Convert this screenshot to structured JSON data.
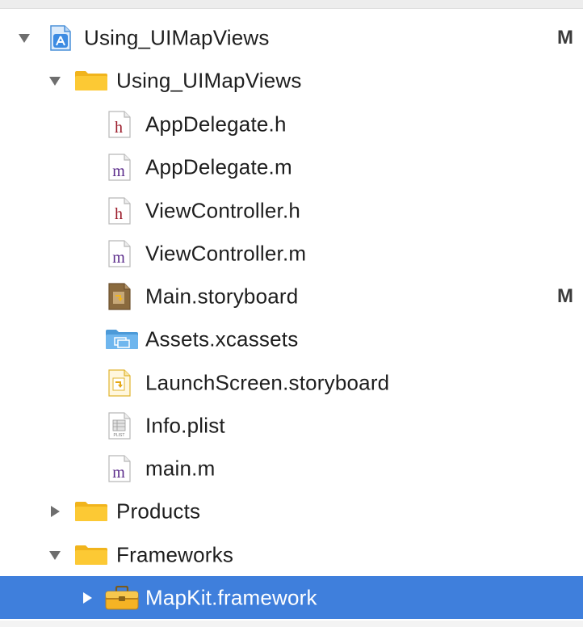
{
  "colors": {
    "selection": "#3f7fdc",
    "header_letter": "#9b1b2a",
    "impl_letter": "#5a2a8a",
    "folder": "#f5c518"
  },
  "tree": {
    "rows": [
      {
        "label": "Using_UIMapViews",
        "icon": "xcode-project-icon",
        "disclosure": "expanded",
        "badge": "M"
      },
      {
        "label": "Using_UIMapViews",
        "icon": "folder-icon",
        "disclosure": "expanded",
        "badge": ""
      },
      {
        "label": "AppDelegate.h",
        "icon": "header-file-icon",
        "letter": "h",
        "badge": ""
      },
      {
        "label": "AppDelegate.m",
        "icon": "objc-file-icon",
        "letter": "m",
        "badge": ""
      },
      {
        "label": "ViewController.h",
        "icon": "header-file-icon",
        "letter": "h",
        "badge": ""
      },
      {
        "label": "ViewController.m",
        "icon": "objc-file-icon",
        "letter": "m",
        "badge": ""
      },
      {
        "label": "Main.storyboard",
        "icon": "storyboard-icon",
        "badge": "M"
      },
      {
        "label": "Assets.xcassets",
        "icon": "asset-catalog-icon",
        "badge": ""
      },
      {
        "label": "LaunchScreen.storyboard",
        "icon": "launchscreen-storyboard-icon",
        "badge": ""
      },
      {
        "label": "Info.plist",
        "icon": "plist-file-icon",
        "icon_text": "PLIST",
        "badge": ""
      },
      {
        "label": "main.m",
        "icon": "objc-file-icon",
        "letter": "m",
        "badge": ""
      },
      {
        "label": "Products",
        "icon": "folder-icon",
        "disclosure": "collapsed",
        "badge": ""
      },
      {
        "label": "Frameworks",
        "icon": "folder-icon",
        "disclosure": "expanded",
        "badge": ""
      },
      {
        "label": "MapKit.framework",
        "icon": "framework-toolbox-icon",
        "disclosure": "collapsed",
        "badge": "",
        "selected": true
      }
    ]
  }
}
